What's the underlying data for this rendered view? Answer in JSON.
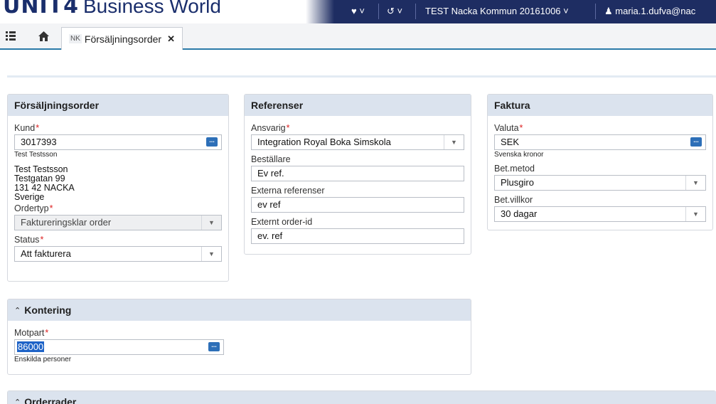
{
  "header": {
    "logo": "UNIT4",
    "product": "Business World",
    "favorites_label": "♥ ˅",
    "history_label": "↺ ˅",
    "company": "TEST Nacka Kommun 20161006",
    "company_chevron": "˅",
    "user": "maria.1.dufva@nac"
  },
  "tabbar": {
    "menu_icon": "menu-icon",
    "home_icon": "home-icon",
    "tabs": [
      {
        "badge": "NK",
        "label": "Försäljningsorder",
        "close": "✕"
      }
    ]
  },
  "panels": {
    "order": {
      "title": "Försäljningsorder",
      "kund_label": "Kund",
      "kund_value": "3017393",
      "kund_name": "Test Testsson",
      "address": [
        "Test Testsson",
        "Testgatan 99",
        "131 42 NACKA",
        "Sverige"
      ],
      "ordertyp_label": "Ordertyp",
      "ordertyp_value": "Faktureringsklar order",
      "status_label": "Status",
      "status_value": "Att fakturera"
    },
    "references": {
      "title": "Referenser",
      "ansvarig_label": "Ansvarig",
      "ansvarig_value": "Integration Royal Boka Simskola",
      "bestallare_label": "Beställare",
      "bestallare_value": "Ev ref.",
      "externa_label": "Externa referenser",
      "externa_value": "ev ref",
      "externt_label": "Externt order-id",
      "externt_value": "ev. ref"
    },
    "invoice": {
      "title": "Faktura",
      "valuta_label": "Valuta",
      "valuta_value": "SEK",
      "valuta_name": "Svenska kronor",
      "betmetod_label": "Bet.metod",
      "betmetod_value": "Plusgiro",
      "betvillkor_label": "Bet.villkor",
      "betvillkor_value": "30 dagar"
    },
    "kontering": {
      "title": "Kontering",
      "motpart_label": "Motpart",
      "motpart_value": "86000",
      "motpart_name": "Enskilda personer"
    },
    "orderrader": {
      "title": "Orderrader"
    }
  },
  "colors": {
    "header_bg": "#1e2d62",
    "panel_head_bg": "#dbe3ee",
    "required": "#d22222",
    "accent": "#2a7aa8"
  }
}
